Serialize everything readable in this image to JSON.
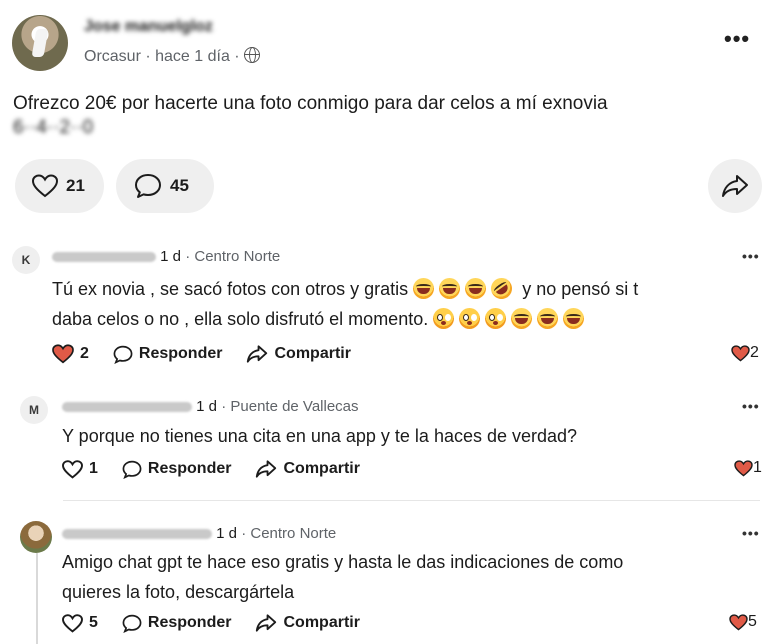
{
  "post": {
    "author": "Jose manuelgloz",
    "location": "Orcasur",
    "time": "hace 1 día",
    "text_line1": "Ofrezco 20€ por hacerte una foto conmigo para dar celos a mí exnovia",
    "text_line2": "6··4··2··0",
    "likes": "21",
    "comments": "45"
  },
  "comments": [
    {
      "initial": "K",
      "time": "1 d",
      "location": "Centro Norte",
      "line1": "Tú ex novia , se sacó fotos con otros y gratis",
      "line1_after": "y no pensó si t",
      "line2": "daba celos o no , ella solo disfrutó el momento.",
      "likes": "2",
      "right_likes": "2",
      "reply_label": "Responder",
      "share_label": "Compartir"
    },
    {
      "initial": "M",
      "time": "1 d",
      "location": "Puente de Vallecas",
      "line1": "Y porque no tienes una cita en una app y te la haces de verdad?",
      "likes": "1",
      "right_likes": "1",
      "reply_label": "Responder",
      "share_label": "Compartir"
    },
    {
      "initial": "",
      "time": "1 d",
      "location": "Centro Norte",
      "line1": "Amigo chat gpt te hace eso gratis y hasta le das indicaciones de como",
      "line2": "quieres la foto, descargártela",
      "likes": "5",
      "right_likes": "5",
      "reply_label": "Responder",
      "share_label": "Compartir"
    }
  ],
  "colors": {
    "accent_like": "#e05a47",
    "pill_bg": "#efefef",
    "muted": "#5f6368"
  },
  "icons": [
    "globe-icon",
    "heart-icon",
    "comment-icon",
    "share-icon",
    "more-icon"
  ]
}
